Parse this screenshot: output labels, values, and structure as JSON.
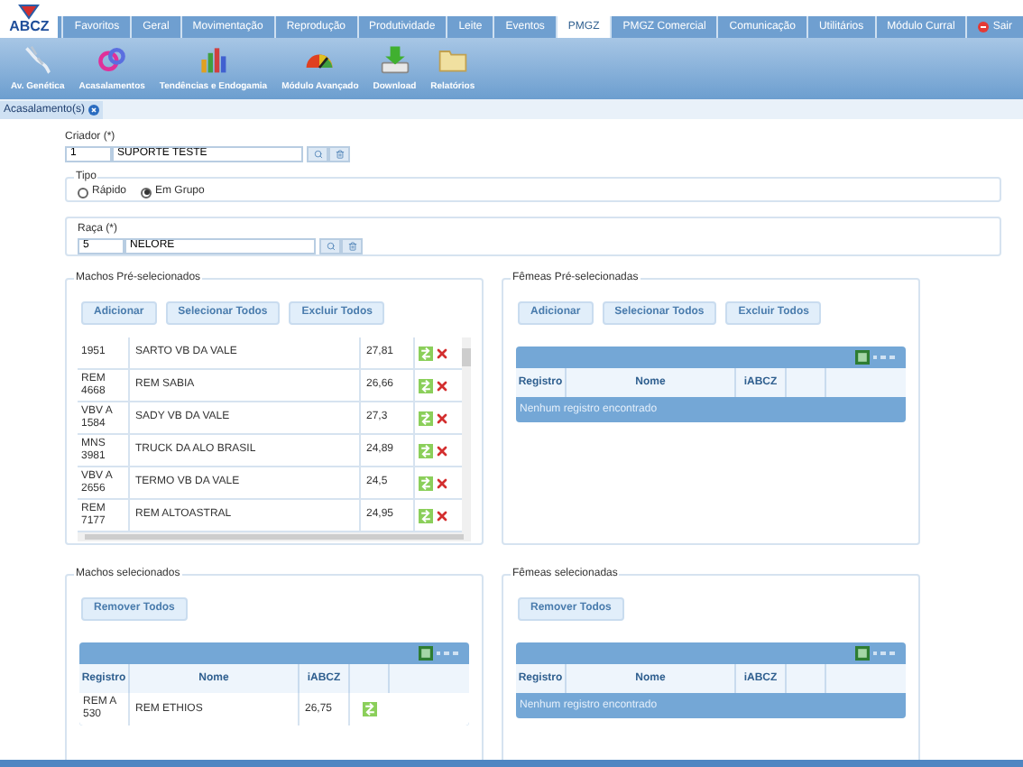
{
  "header": {
    "logo": "ABCZ",
    "tabs": [
      {
        "label": "Favoritos",
        "selected": false,
        "kind": "tab"
      },
      {
        "label": "Geral",
        "selected": false,
        "kind": "tab"
      },
      {
        "label": "Movimentação",
        "selected": false,
        "kind": "tab"
      },
      {
        "label": "Reprodução",
        "selected": false,
        "kind": "tab"
      },
      {
        "label": "Produtividade",
        "selected": false,
        "kind": "tab"
      },
      {
        "label": "Leite",
        "selected": false,
        "kind": "tab"
      },
      {
        "label": "Eventos",
        "selected": false,
        "kind": "tab"
      },
      {
        "label": "PMGZ",
        "selected": true,
        "kind": "tab"
      },
      {
        "label": "PMGZ Comercial",
        "selected": false,
        "kind": "tab"
      },
      {
        "label": "Comunicação",
        "selected": false,
        "kind": "tab"
      },
      {
        "label": "Utilitários",
        "selected": false,
        "kind": "tab"
      },
      {
        "label": "Módulo Curral",
        "selected": false,
        "kind": "tab"
      },
      {
        "label": "Sair",
        "selected": false,
        "kind": "exit"
      }
    ]
  },
  "toolbar": [
    {
      "label": "Av. Genética",
      "kind": "dna"
    },
    {
      "label": "Acasalamentos",
      "kind": "mating"
    },
    {
      "label": "Tendências e Endogamia",
      "kind": "bars"
    },
    {
      "label": "Módulo Avançado",
      "kind": "gauge"
    },
    {
      "label": "Download",
      "kind": "download"
    },
    {
      "label": "Relatórios",
      "kind": "folder"
    }
  ],
  "open_tabs": [
    {
      "label": "Acasalamento(s)",
      "selected": true
    }
  ],
  "criador": {
    "label": "Criador (*)",
    "code": "1",
    "name": "SUPORTE TESTE"
  },
  "tipo": {
    "legend": "Tipo",
    "options": [
      {
        "label": "Rápido",
        "selected": false
      },
      {
        "label": "Em Grupo",
        "selected": true
      }
    ]
  },
  "raca": {
    "label": "Raça (*)",
    "code": "5",
    "name": "NELORE"
  },
  "panels": [
    {
      "legend": "Machos Pré-selecionados",
      "kind": "list",
      "buttons": [
        "Adicionar",
        "Selecionar Todos",
        "Excluir Todos"
      ],
      "rows": [
        {
          "registro": "1951",
          "nome": "SARTO VB DA VALE",
          "iabcz": "27,81"
        },
        {
          "registro": "REM 4668",
          "nome": "REM SABIA",
          "iabcz": "26,66"
        },
        {
          "registro": "VBV A 1584",
          "nome": "SADY VB DA VALE",
          "iabcz": "27,3"
        },
        {
          "registro": "MNS 3981",
          "nome": "TRUCK DA ALO BRASIL",
          "iabcz": "24,89"
        },
        {
          "registro": "VBV A 2656",
          "nome": "TERMO VB DA VALE",
          "iabcz": "24,5"
        },
        {
          "registro": "REM 7177",
          "nome": "REM ALTOASTRAL",
          "iabcz": "24,95"
        }
      ]
    },
    {
      "legend": "Fêmeas Pré-selecionadas",
      "kind": "grid",
      "buttons": [
        "Adicionar",
        "Selecionar Todos",
        "Excluir Todos"
      ],
      "columns": [
        "Registro",
        "Nome",
        "iABCZ"
      ],
      "empty_message": "Nenhum registro encontrado"
    },
    {
      "legend": "Machos selecionados",
      "kind": "grid",
      "buttons": [
        "Remover Todos"
      ],
      "columns": [
        "Registro",
        "Nome",
        "iABCZ"
      ],
      "rows": [
        {
          "registro": "REM A 530",
          "nome": "REM ETHIOS",
          "iabcz": "26,75"
        }
      ]
    },
    {
      "legend": "Fêmeas selecionadas",
      "kind": "grid",
      "buttons": [
        "Remover Todos"
      ],
      "columns": [
        "Registro",
        "Nome",
        "iABCZ"
      ],
      "empty_message": "Nenhum registro encontrado"
    }
  ]
}
